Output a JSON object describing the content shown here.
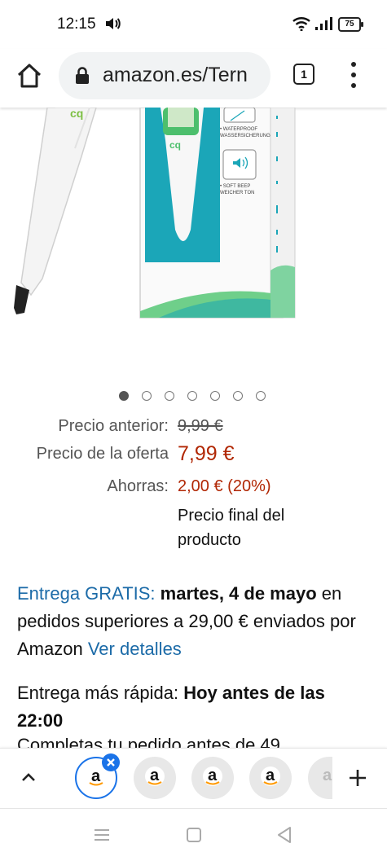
{
  "status_bar": {
    "time": "12:15",
    "battery": "75",
    "icons": [
      "sound-icon",
      "wifi-icon",
      "signal-icon",
      "battery-icon"
    ]
  },
  "browser": {
    "url": "amazon.es/Tern",
    "tab_count": "1",
    "icons": [
      "home-icon",
      "lock-icon",
      "tab-switcher-icon",
      "menu-dots-icon"
    ]
  },
  "product_image": {
    "packaging_text": [
      "• WATERPROOF",
      "WASSERSICHERUNG",
      "• SOFT BEEP",
      "WEICHER TON"
    ],
    "colors": {
      "teal": "#1ba6b8",
      "green": "#4dbf6d"
    }
  },
  "carousel": {
    "total": 7,
    "active_index": 0
  },
  "prices": {
    "previous_label": "Precio anterior:",
    "previous_value": "9,99 €",
    "deal_label": "Precio de la oferta",
    "deal_value": "7,99 €",
    "savings_label": "Ahorras:",
    "savings_value": "2,00 € (20%)",
    "final_note": "Precio final del producto"
  },
  "delivery": {
    "free_label": "Entrega GRATIS:",
    "date": "martes, 4 de mayo",
    "condition": "en pedidos superiores a 29,00 € enviados por Amazon",
    "details_link": "Ver detalles",
    "fast_label": "Entrega más rápida:",
    "fast_time": "Hoy antes de las 22:00",
    "cutoff_partial": "Completas tu pedido antes de 49"
  },
  "tab_strip": {
    "tab_logos": [
      "a",
      "a",
      "a",
      "a",
      "a"
    ],
    "icons": [
      "chevron-up-icon",
      "close-icon",
      "plus-icon"
    ]
  },
  "nav_bar": {
    "icons": [
      "recents-icon",
      "home-nav-icon",
      "back-icon"
    ]
  },
  "colors": {
    "price_red": "#b12704",
    "link_blue": "#1c6ba8",
    "chrome_blue": "#1a73e8"
  }
}
